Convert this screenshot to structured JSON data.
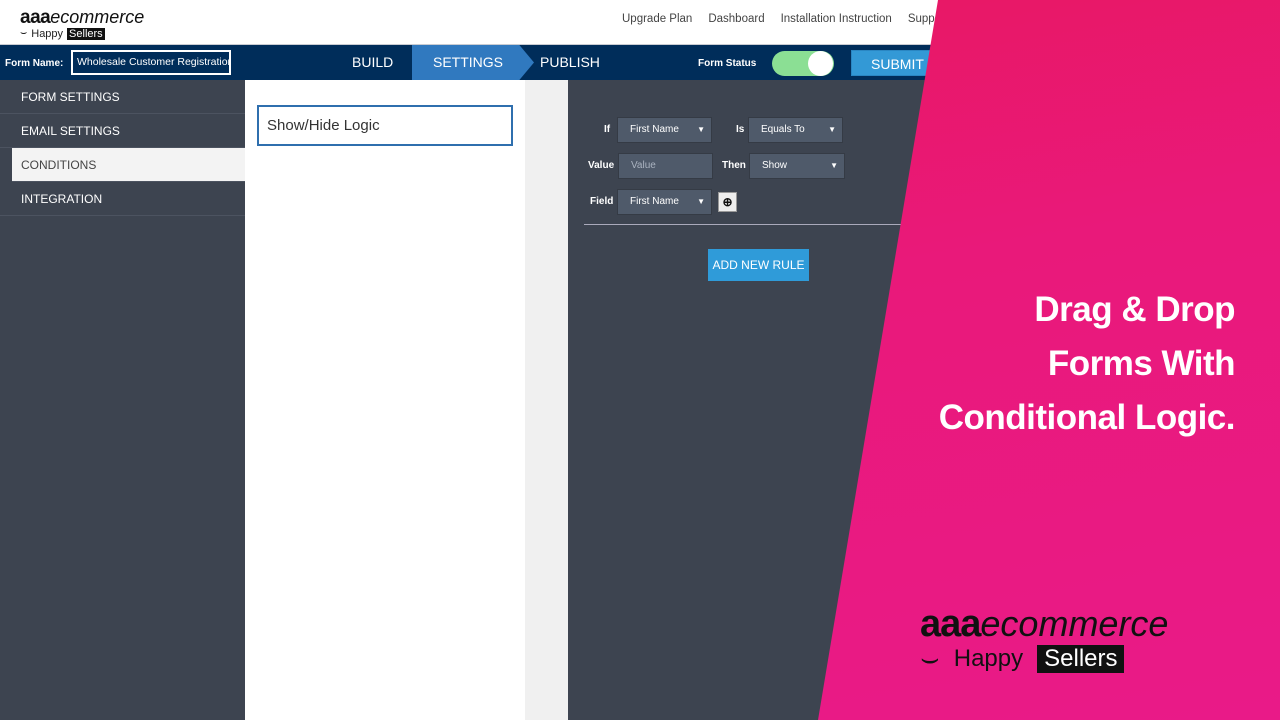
{
  "brand": {
    "bold": "aaa",
    "rest": "ecommerce",
    "tag1": "Happy",
    "tag2": "Sellers"
  },
  "topnav": [
    "Upgrade Plan",
    "Dashboard",
    "Installation Instruction",
    "Support"
  ],
  "toolbar": {
    "form_name_label": "Form Name:",
    "form_name_value": "Wholesale Customer Registration",
    "steps": [
      "BUILD",
      "SETTINGS",
      "PUBLISH"
    ],
    "active_step": "SETTINGS",
    "form_status_label": "Form Status",
    "form_status_on": true,
    "submit_label": "SUBMIT"
  },
  "sidebar": {
    "items": [
      "FORM SETTINGS",
      "EMAIL SETTINGS",
      "CONDITIONS",
      "INTEGRATION"
    ],
    "active": "CONDITIONS"
  },
  "panel": {
    "logic_title": "Show/Hide Logic"
  },
  "rule": {
    "if_label": "If",
    "if_value": "First Name",
    "is_label": "Is",
    "is_value": "Equals To",
    "value_label": "Value",
    "value_placeholder": "Value",
    "then_label": "Then",
    "then_value": "Show",
    "field_label": "Field",
    "field_value": "First Name"
  },
  "add_rule_label": "ADD NEW RULE",
  "promo": {
    "lines": [
      "Drag & Drop",
      "Forms With",
      "Conditional Logic."
    ]
  },
  "colors": {
    "nav_bar": "#002d5a",
    "active_tab": "#3079bf",
    "submit": "#3399d6",
    "toggle_on": "#8bdf94",
    "promo_pink": "#e91a88"
  }
}
